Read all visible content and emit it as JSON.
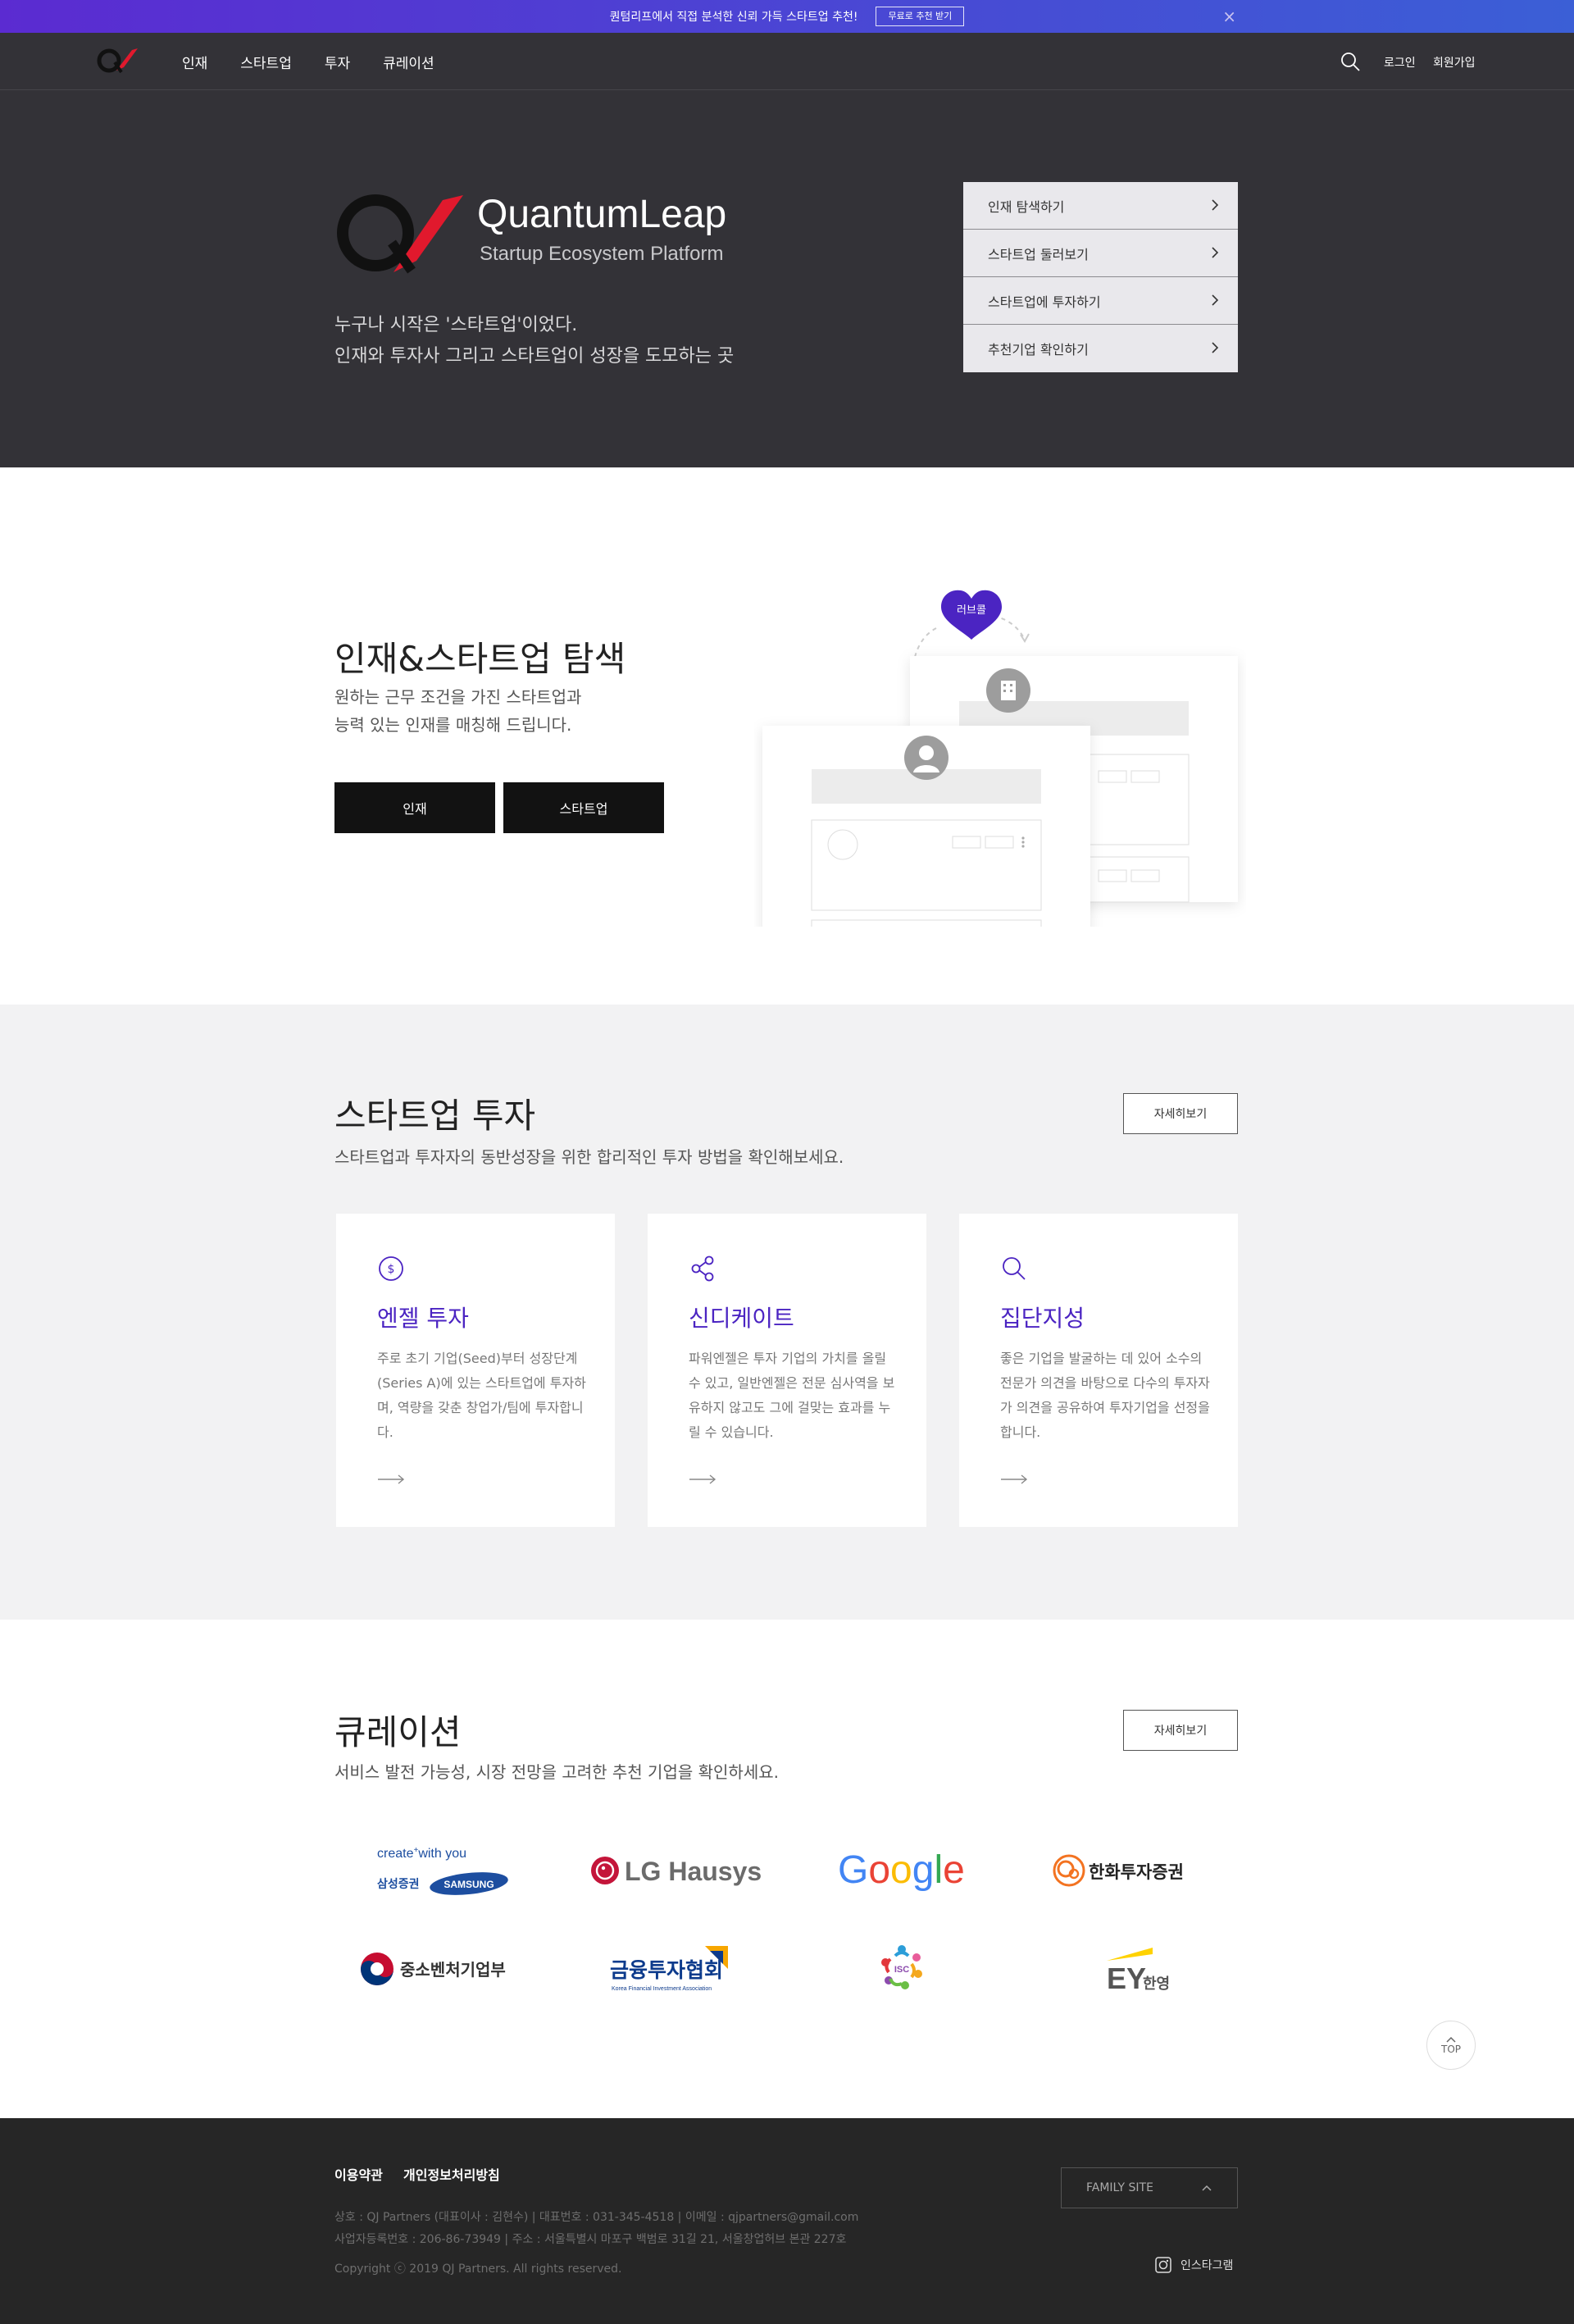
{
  "promo": {
    "text": "퀀텀리프에서 직접 분석한 신뢰 가득 스타트업 추천!",
    "button": "무료로 추천 받기"
  },
  "header": {
    "nav": [
      "인재",
      "스타트업",
      "투자",
      "큐레이션"
    ],
    "login": "로그인",
    "signup": "회원가입"
  },
  "hero": {
    "brand_name": "QuantumLeap",
    "brand_sub": "Startup Ecosystem Platform",
    "tagline1": "누구나 시작은 '스타트업'이었다.",
    "tagline2": "인재와 투자사 그리고 스타트업이 성장을 도모하는 곳",
    "quick_menu": [
      "인재 탐색하기",
      "스타트업 둘러보기",
      "스타트업에 투자하기",
      "추천기업 확인하기"
    ]
  },
  "explore": {
    "title": "인재&스타트업 탐색",
    "desc1": "원하는 근무 조건을 가진 스타트업과",
    "desc2": "능력 있는 인재를 매칭해 드립니다.",
    "btn_talent": "인재",
    "btn_startup": "스타트업",
    "heart_label": "러브콜"
  },
  "invest": {
    "title": "스타트업 투자",
    "desc": "스타트업과 투자자의 동반성장을 위한 합리적인 투자 방법을 확인해보세요.",
    "more": "자세히보기",
    "cards": [
      {
        "title": "엔젤 투자",
        "text": "주로 초기 기업(Seed)부터 성장단계(Series A)에 있는 스타트업에 투자하며, 역량을 갖춘 창업가/팀에 투자합니다.",
        "icon": "dollar-icon"
      },
      {
        "title": "신디케이트",
        "text": "파워엔젤은 투자 기업의 가치를 올릴 수 있고, 일반엔젤은 전문 심사역을 보유하지 않고도 그에 걸맞는 효과를 누릴 수 있습니다.",
        "icon": "share-icon"
      },
      {
        "title": "집단지성",
        "text": "좋은 기업을 발굴하는 데 있어 소수의 전문가 의견을 바탕으로 다수의 투자자가 의견을 공유하여 투자기업을 선정을 합니다.",
        "icon": "search-icon"
      }
    ]
  },
  "curation": {
    "title": "큐레이션",
    "desc": "서비스 발전 가능성, 시장 전망을 고려한 추천 기업을 확인하세요.",
    "more": "자세히보기",
    "logos": {
      "samsung_top": "create",
      "samsung_sup": "+",
      "samsung_top2": "with you",
      "samsung_kr": "삼성증권",
      "samsung_en": "SAMSUNG",
      "lg": "LG Hausys",
      "google": [
        "G",
        "o",
        "o",
        "g",
        "l",
        "e"
      ],
      "hanwha": "한화투자증권",
      "smes": "중소벤처기업부",
      "kofia": "금융투자협회",
      "kofia_en": "Korea Financial Investment Association",
      "isc": "ISC",
      "ey": "EY",
      "ey_kr": "한영"
    }
  },
  "top_button": "TOP",
  "footer": {
    "terms": "이용약관",
    "privacy": "개인정보처리방침",
    "info1": "상호 : QJ Partners (대표이사 : 김현수)  |  대표번호 : 031-345-4518  |  이메일 : qjpartners@gmail.com",
    "info2": "사업자등록번호 : 206-86-73949  |  주소 : 서울특별시 마포구 백범로 31길 21, 서울창업허브 본관 227호",
    "copyright": "Copyright ⓒ 2019 QJ Partners. All rights reserved.",
    "family_site": "FAMILY SITE",
    "instagram": "인스타그램"
  },
  "colors": {
    "accent": "#4b24c2",
    "dark_bg": "#333237",
    "footer_bg": "#262626"
  }
}
